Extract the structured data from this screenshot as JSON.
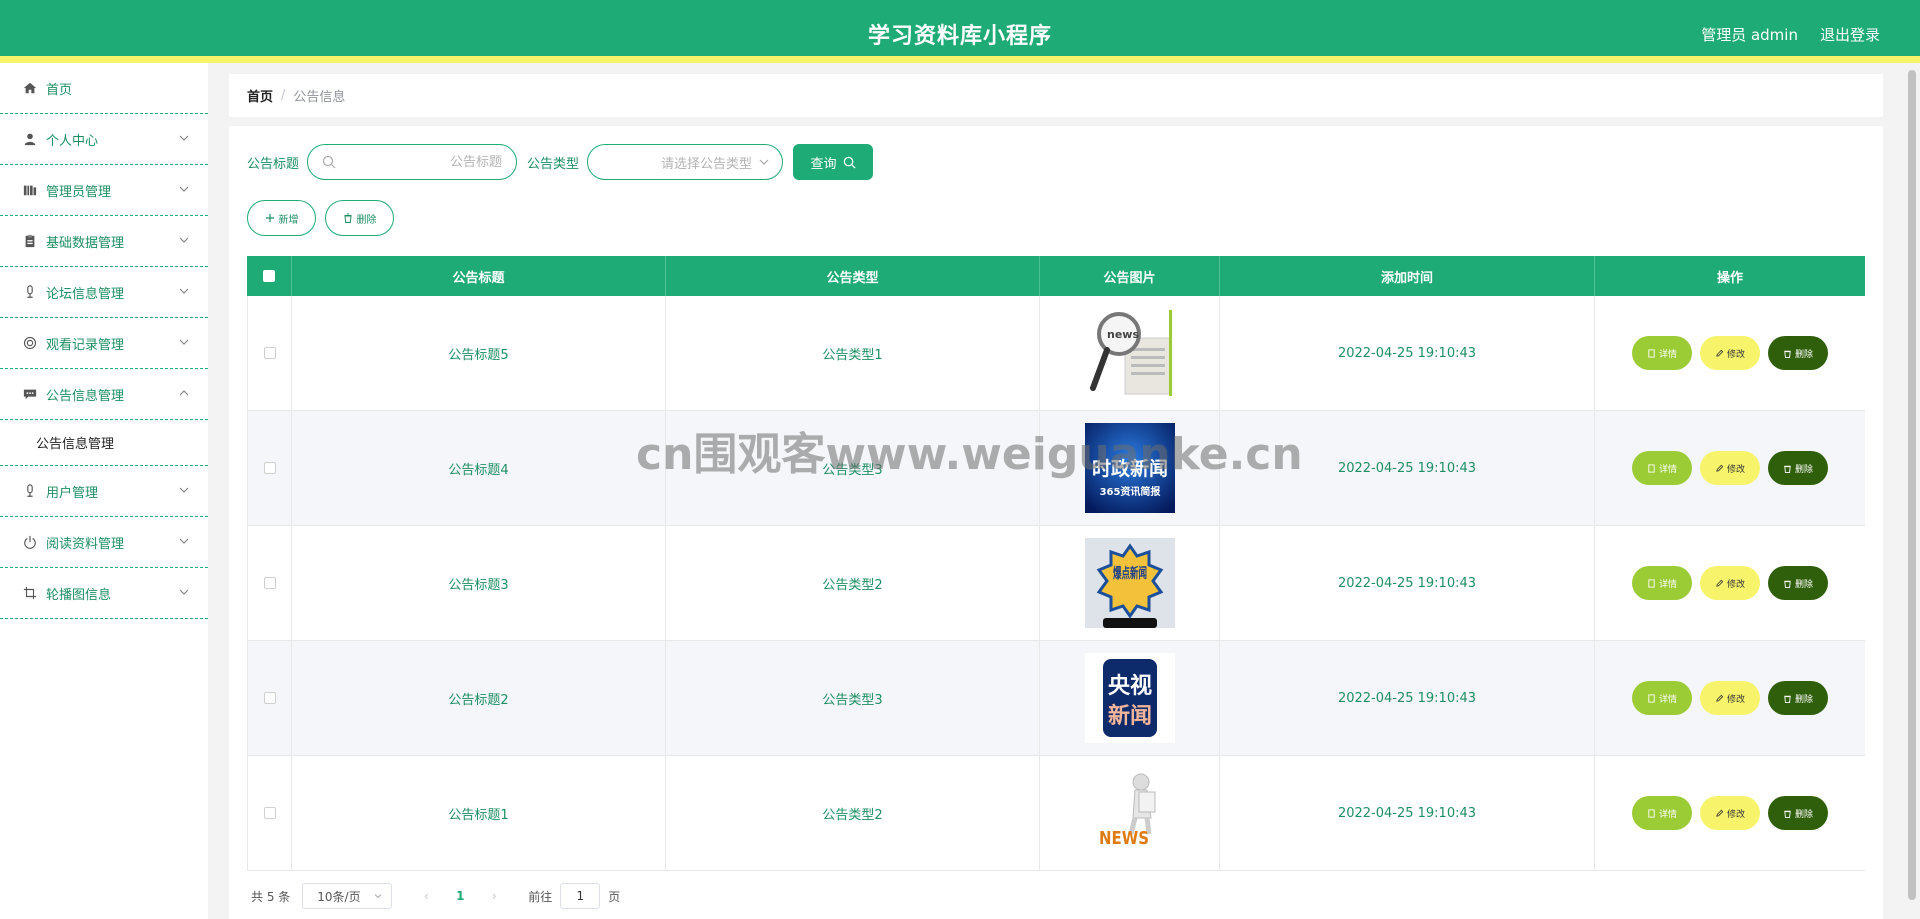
{
  "header": {
    "title": "学习资料库小程序",
    "user": "管理员 admin",
    "logout": "退出登录"
  },
  "sidebar": {
    "items": [
      {
        "label": "首页",
        "icon": "home-icon"
      },
      {
        "label": "个人中心",
        "icon": "user-icon"
      },
      {
        "label": "管理员管理",
        "icon": "bars-icon"
      },
      {
        "label": "基础数据管理",
        "icon": "clipboard-icon"
      },
      {
        "label": "论坛信息管理",
        "icon": "mic-icon"
      },
      {
        "label": "观看记录管理",
        "icon": "target-icon"
      },
      {
        "label": "公告信息管理",
        "icon": "message-icon"
      },
      {
        "label": "用户管理",
        "icon": "mic-icon"
      },
      {
        "label": "阅读资料管理",
        "icon": "power-icon"
      },
      {
        "label": "轮播图信息",
        "icon": "crop-icon"
      }
    ],
    "submenu_label": "公告信息管理"
  },
  "breadcrumb": {
    "home": "首页",
    "separator": "/",
    "current": "公告信息"
  },
  "search": {
    "title_label": "公告标题",
    "title_placeholder": "公告标题",
    "type_label": "公告类型",
    "type_placeholder": "请选择公告类型",
    "query_label": "查询"
  },
  "actions": {
    "add_label": "新增",
    "delete_label": "删除"
  },
  "table": {
    "headers": [
      "公告标题",
      "公告类型",
      "公告图片",
      "添加时间",
      "操作"
    ],
    "rows": [
      {
        "title": "公告标题5",
        "type": "公告类型1",
        "time": "2022-04-25 19:10:43",
        "image": "news-magnifier"
      },
      {
        "title": "公告标题4",
        "type": "公告类型3",
        "time": "2022-04-25 19:10:43",
        "image": "current-affairs-news"
      },
      {
        "title": "公告标题3",
        "type": "公告类型2",
        "time": "2022-04-25 19:10:43",
        "image": "breaking-news"
      },
      {
        "title": "公告标题2",
        "type": "公告类型3",
        "time": "2022-04-25 19:10:43",
        "image": "cctv-news"
      },
      {
        "title": "公告标题1",
        "type": "公告类型2",
        "time": "2022-04-25 19:10:43",
        "image": "news-3d-figure"
      }
    ],
    "ops": {
      "detail": "详情",
      "edit": "修改",
      "delete": "删除"
    }
  },
  "pagination": {
    "total": "共 5 条",
    "page_size": "10条/页",
    "current_page": "1",
    "goto_label": "前往",
    "goto_value": "1",
    "page_suffix": "页"
  },
  "image_text": {
    "news": "news",
    "current_affairs": "时政新闻",
    "current_affairs_sub": "365资讯简报",
    "breaking": "爆点新闻",
    "cctv_line1": "央视",
    "cctv_line2": "新闻",
    "news_3d": "NEWS"
  },
  "watermark": "cn围观客www.weiguanke.cn",
  "colors": {
    "primary": "#1fab75",
    "accent_yellow": "#f7f46b",
    "detail_btn": "#9bcb35",
    "delete_btn": "#2f5f0a"
  }
}
